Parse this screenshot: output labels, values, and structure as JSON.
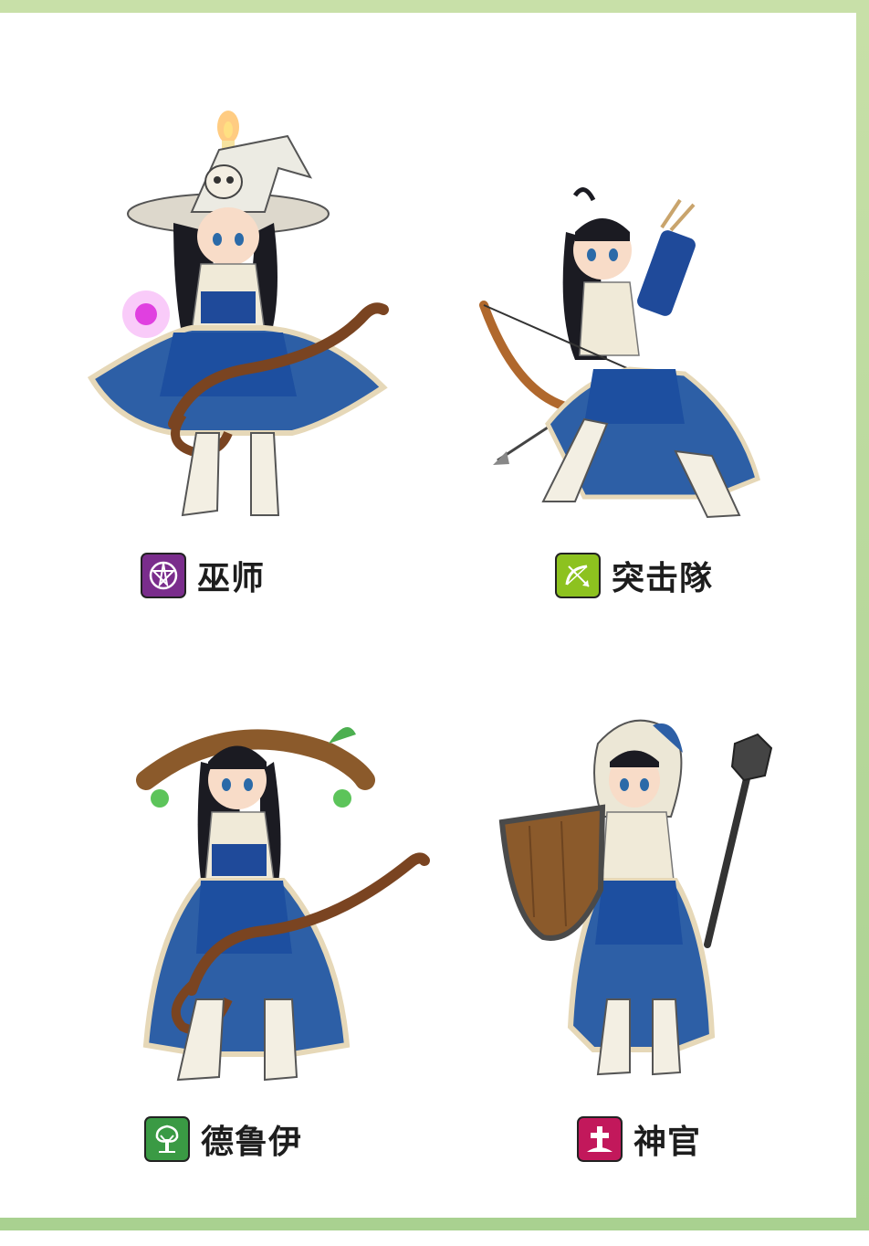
{
  "colors": {
    "frame": "#b5d69a",
    "wizard_badge": "#7a2d8c",
    "ranger_badge": "#8dc21f",
    "druid_badge": "#3a9a44",
    "priest_badge": "#c2185b"
  },
  "classes": [
    {
      "id": "wizard",
      "name": "巫师",
      "icon": "pentagram-icon"
    },
    {
      "id": "ranger",
      "name": "突击隊",
      "icon": "bow-arrow-icon"
    },
    {
      "id": "druid",
      "name": "德鲁伊",
      "icon": "tree-icon"
    },
    {
      "id": "priest",
      "name": "神官",
      "icon": "grave-cross-icon"
    }
  ]
}
